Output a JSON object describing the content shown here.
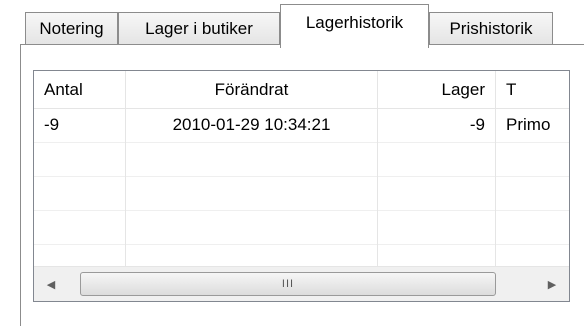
{
  "tabs": [
    {
      "label": "Notering",
      "active": false
    },
    {
      "label": "Lager i butiker",
      "active": false
    },
    {
      "label": "Lagerhistorik",
      "active": true
    },
    {
      "label": "Prishistorik",
      "active": false
    }
  ],
  "table": {
    "columns": [
      "Antal",
      "Förändrat",
      "Lager",
      "T"
    ],
    "rows": [
      [
        "-9",
        "2010-01-29 10:34:21",
        "-9",
        "Primo"
      ]
    ]
  },
  "scrollbar": {
    "left_arrow": "◀",
    "right_arrow": "▶",
    "grip": "III"
  }
}
